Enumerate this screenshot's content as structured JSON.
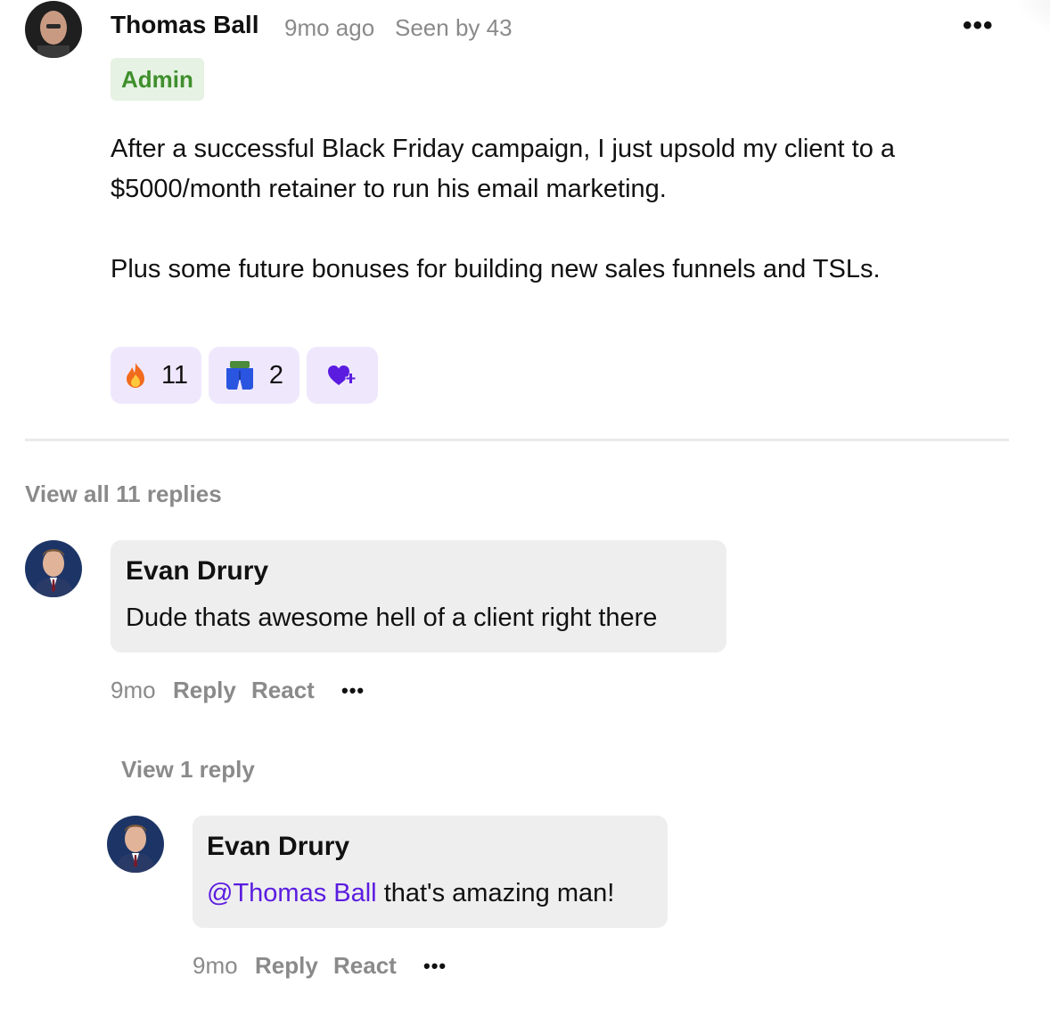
{
  "post": {
    "author": "Thomas Ball",
    "time": "9mo ago",
    "seen": "Seen by 43",
    "badge": "Admin",
    "paragraphs": [
      "After a successful Black Friday campaign, I just upsold my client to a",
      "$5000/month retainer to run his email marketing.",
      "Plus some future bonuses for building new sales funnels and TSLs."
    ],
    "reactions": [
      {
        "icon": "fire-emoji",
        "count": "11"
      },
      {
        "icon": "blue-shorts-emoji",
        "count": "2"
      }
    ],
    "add_reaction_icon": "heart-plus-icon",
    "accent_color": "#5b1ce0"
  },
  "replies": {
    "view_all": "View all 11 replies",
    "comment1": {
      "author": "Evan Drury",
      "text": "Dude thats awesome hell of a client right there",
      "time": "9mo",
      "reply": "Reply",
      "react": "React",
      "view_replies": "View 1 reply"
    },
    "comment2": {
      "author": "Evan Drury",
      "mention": "@Thomas Ball",
      "text": "that's amazing man!",
      "time": "9mo",
      "reply": "Reply",
      "react": "React"
    }
  }
}
